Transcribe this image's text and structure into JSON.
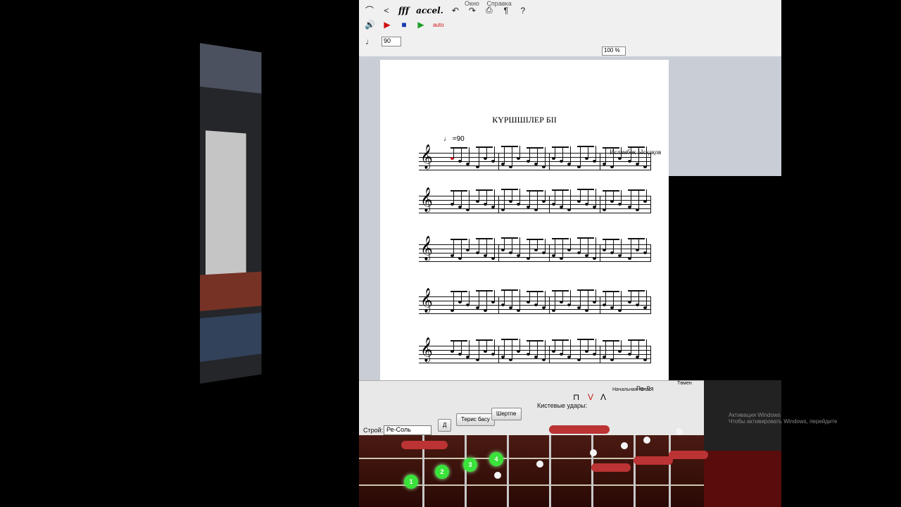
{
  "menu": {
    "items": [
      "Окно",
      "Справка"
    ]
  },
  "toolbar": {
    "dynamics_label": "fff",
    "accel_label": "accel.",
    "auto_label": "auto",
    "tempo_value": "90",
    "zoom_value": "100 %"
  },
  "score": {
    "title": "КҮРШШІЛЕР БІІ",
    "tempo_mark": "♩ =90",
    "composer": "Исламбек Ысқақов"
  },
  "control_panel": {
    "stroy_label": "Строй:",
    "stroy_value": "Ре-Соль",
    "d_button": "Д",
    "ters_basu_button": "Терис басу",
    "shertpe_button": "Шертпе",
    "strokes_label": "Кистевые удары:",
    "start_note_label": "Начальная нота:",
    "start_note_value": "Ре-Ля",
    "tomer_label": "Төмен",
    "finger_labels": [
      "1",
      "2",
      "3",
      "4"
    ]
  },
  "os": {
    "watermark_line1": "Активация Windows",
    "watermark_line2": "Чтобы активировать Windows, перейдите"
  }
}
